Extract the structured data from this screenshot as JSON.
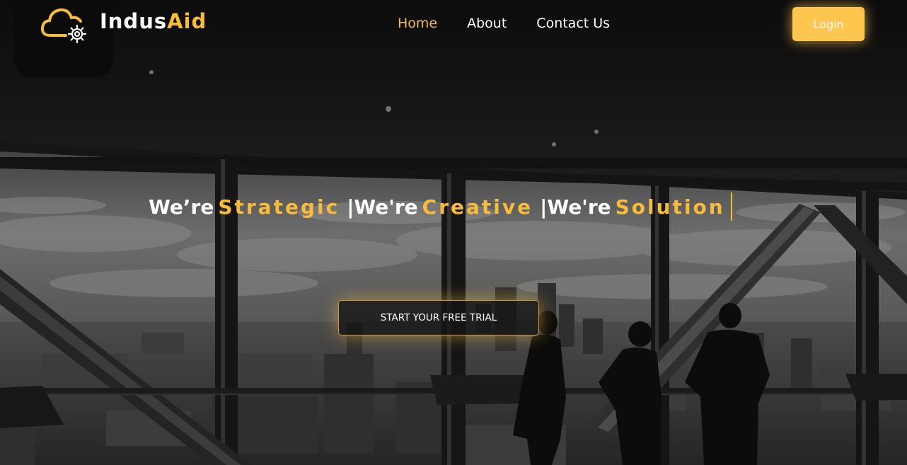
{
  "brand": {
    "name_part1": "Indus",
    "name_part2": "Aid",
    "accent_color": "#f8bb3c"
  },
  "nav": {
    "items": [
      {
        "label": "Home",
        "active": true
      },
      {
        "label": "About",
        "active": false
      },
      {
        "label": "Contact Us",
        "active": false
      }
    ],
    "login_label": "Login"
  },
  "hero": {
    "segments": [
      {
        "prefix": "We’re",
        "highlight": "Strategic"
      },
      {
        "prefix": "We're",
        "highlight": "Creative"
      },
      {
        "prefix": "We're",
        "highlight": "Solution"
      }
    ],
    "separator": "|",
    "cta_label": "START YOUR FREE TRIAL"
  }
}
